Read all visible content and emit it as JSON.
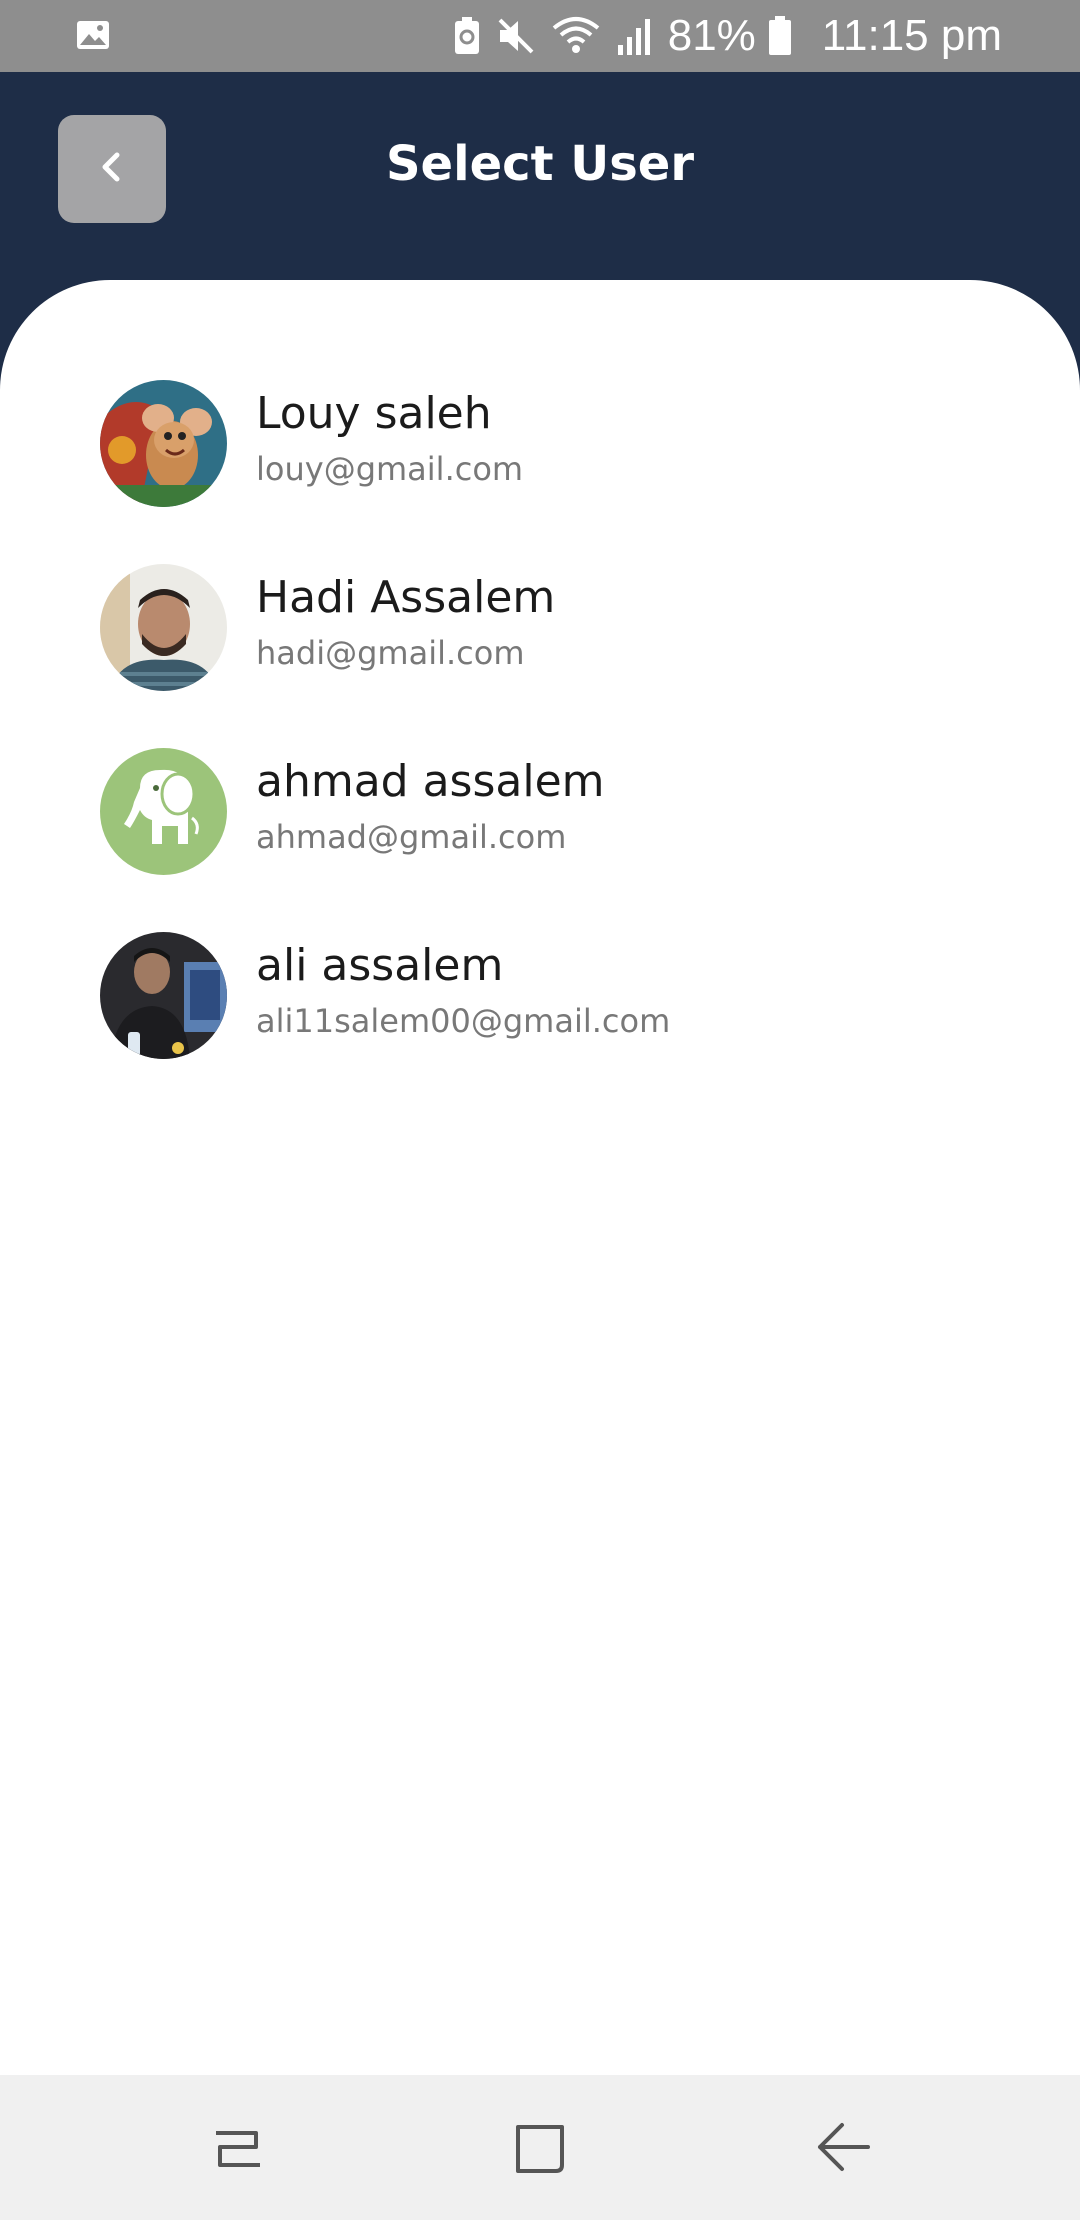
{
  "status_bar": {
    "battery_percent": "81%",
    "time": "11:15 pm",
    "icons": [
      "gallery-icon",
      "battery-saver-icon",
      "mute-icon",
      "wifi-icon",
      "signal-icon",
      "battery-icon"
    ]
  },
  "header": {
    "title": "Select User",
    "back_icon": "chevron-left-icon"
  },
  "users": [
    {
      "name": "Louy saleh",
      "email": "louy@gmail.com",
      "avatar": "cartoon-mouse-avatar"
    },
    {
      "name": "Hadi Assalem",
      "email": "hadi@gmail.com",
      "avatar": "man-photo-avatar"
    },
    {
      "name": "ahmad assalem",
      "email": "ahmad@gmail.com",
      "avatar": "elephant-avatar"
    },
    {
      "name": "ali assalem",
      "email": "ali11salem00@gmail.com",
      "avatar": "man-at-desk-avatar"
    }
  ],
  "nav_bar": {
    "buttons": [
      "recent-apps-icon",
      "home-icon",
      "back-icon"
    ]
  },
  "colors": {
    "header_bg": "#1e2d47",
    "status_bar_bg": "#8e8e8e",
    "back_button_bg": "#a4a4a6",
    "name_text": "#1b1b1b",
    "email_text": "#787878",
    "nav_bar_bg": "#f0f0f0"
  }
}
